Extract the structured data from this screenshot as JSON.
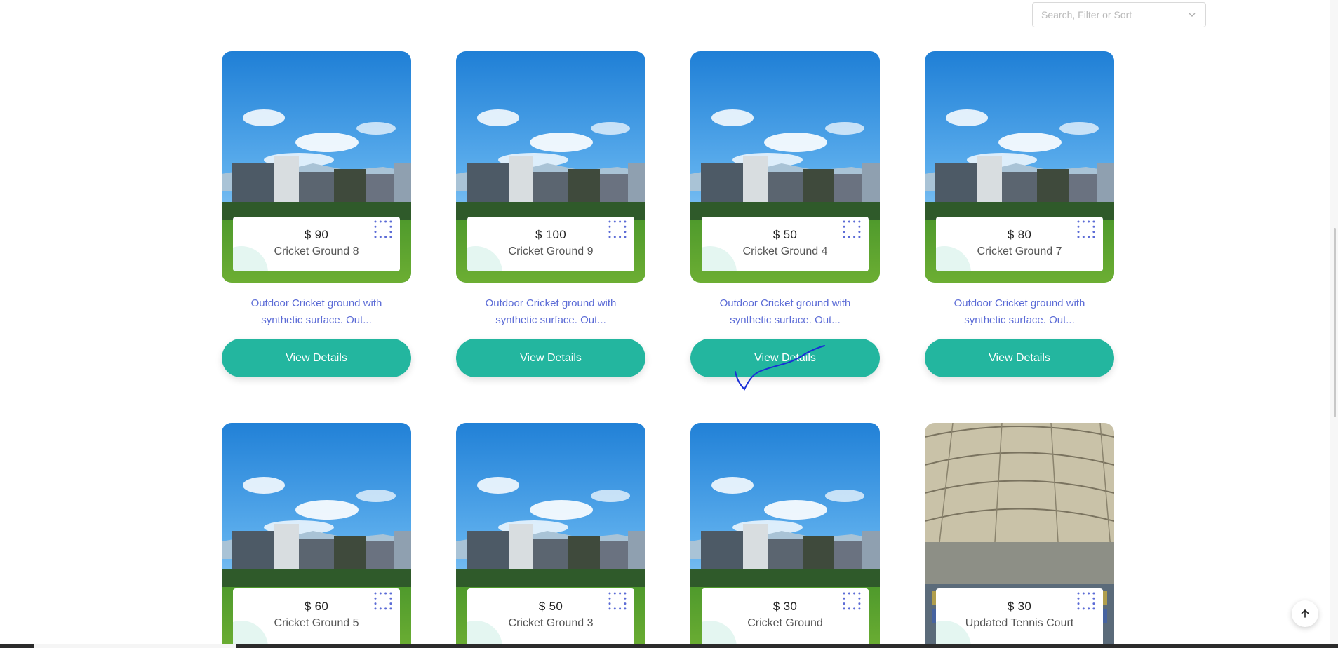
{
  "search": {
    "placeholder": "Search, Filter or Sort"
  },
  "cards": [
    {
      "price": "$ 90",
      "name": "Cricket Ground 8",
      "description": "Outdoor Cricket ground with synthetic surface. Out...",
      "button": "View Details",
      "image": "cricket-ground-photo"
    },
    {
      "price": "$ 100",
      "name": "Cricket Ground 9",
      "description": "Outdoor Cricket ground with synthetic surface. Out...",
      "button": "View Details",
      "image": "cricket-ground-photo"
    },
    {
      "price": "$ 50",
      "name": "Cricket Ground 4",
      "description": "Outdoor Cricket ground with synthetic surface. Out...",
      "button": "View Details",
      "image": "cricket-ground-photo"
    },
    {
      "price": "$ 80",
      "name": "Cricket Ground 7",
      "description": "Outdoor Cricket ground with synthetic surface. Out...",
      "button": "View Details",
      "image": "cricket-ground-photo"
    },
    {
      "price": "$ 60",
      "name": "Cricket Ground 5",
      "image": "cricket-ground-photo"
    },
    {
      "price": "$ 50",
      "name": "Cricket Ground 3",
      "image": "cricket-ground-photo"
    },
    {
      "price": "$ 30",
      "name": "Cricket Ground",
      "image": "cricket-ground-photo"
    },
    {
      "price": "$ 30",
      "name": "Updated Tennis Court",
      "image": "stadium-roof-photo"
    }
  ],
  "colors": {
    "accent": "#23b69f",
    "description_text": "#5b6bd6",
    "dots": "#5b6bd6",
    "blob": "#e4f6f1",
    "annotation_ink": "#1a2fd6"
  },
  "icons": {
    "search_dropdown": "chevron-down-icon",
    "back_to_top": "arrow-up-icon",
    "card_decoration": "dots-grid-icon"
  }
}
